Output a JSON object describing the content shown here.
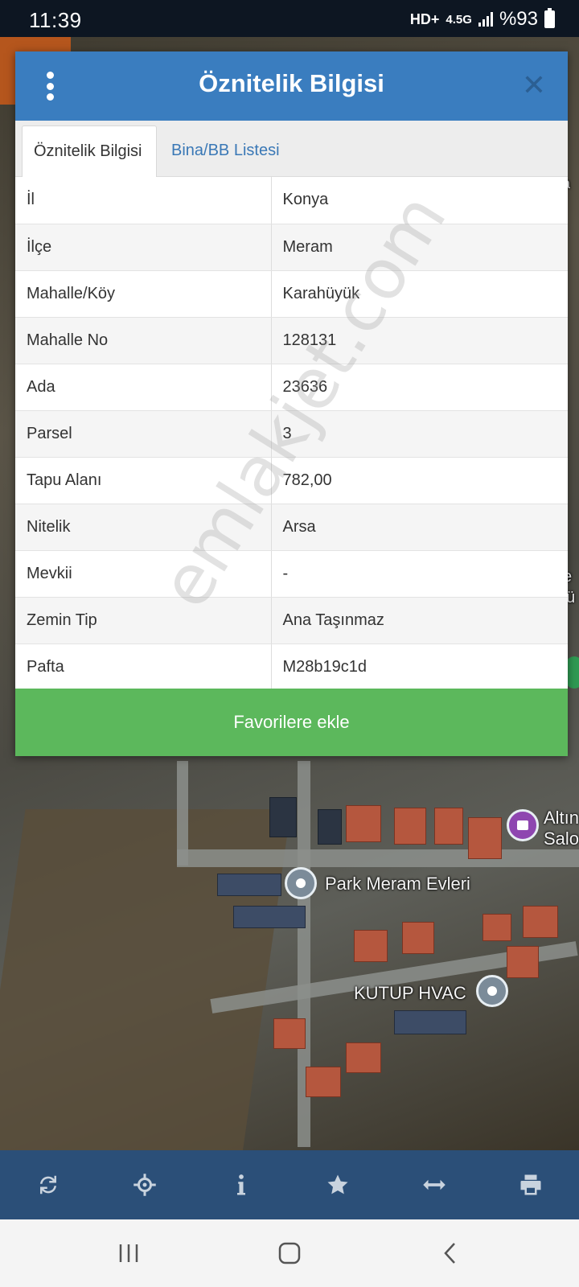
{
  "status_bar": {
    "time": "11:39",
    "hd_label": "HD+",
    "network": "4.5G",
    "battery": "%93"
  },
  "map": {
    "labels": {
      "park": "Park Meram Evleri",
      "kutup": "KUTUP HVAC",
      "altin_line1": "Altın",
      "altin_line2": "Salo",
      "side_top": "ta",
      "side_mid1": "l e",
      "side_mid2": "yü"
    }
  },
  "dialog": {
    "title": "Öznitelik Bilgisi",
    "menu_icon": "kebab-menu-icon",
    "close_icon": "close-icon",
    "tabs": [
      {
        "label": "Öznitelik Bilgisi",
        "active": true
      },
      {
        "label": "Bina/BB Listesi",
        "active": false
      }
    ],
    "rows": [
      {
        "key": "İl",
        "value": "Konya"
      },
      {
        "key": "İlçe",
        "value": "Meram"
      },
      {
        "key": "Mahalle/Köy",
        "value": "Karahüyük"
      },
      {
        "key": "Mahalle No",
        "value": "128131"
      },
      {
        "key": "Ada",
        "value": "23636"
      },
      {
        "key": "Parsel",
        "value": "3"
      },
      {
        "key": "Tapu Alanı",
        "value": "782,00"
      },
      {
        "key": "Nitelik",
        "value": "Arsa"
      },
      {
        "key": "Mevkii",
        "value": "-"
      },
      {
        "key": "Zemin Tip",
        "value": "Ana Taşınmaz"
      },
      {
        "key": "Pafta",
        "value": "M28b19c1d"
      }
    ],
    "favorite_button": "Favorilere ekle",
    "header_color": "#3a7dbf",
    "favorite_color": "#5cb85c"
  },
  "watermark": "emlakjet.com",
  "toolbar": {
    "color": "#2b4f78",
    "icons": [
      "refresh-icon",
      "locate-crosshair-icon",
      "info-icon",
      "star-icon",
      "measure-arrows-icon",
      "print-icon"
    ]
  },
  "nav_bar": {
    "icons": [
      "recent-apps-icon",
      "home-icon",
      "back-icon"
    ]
  }
}
